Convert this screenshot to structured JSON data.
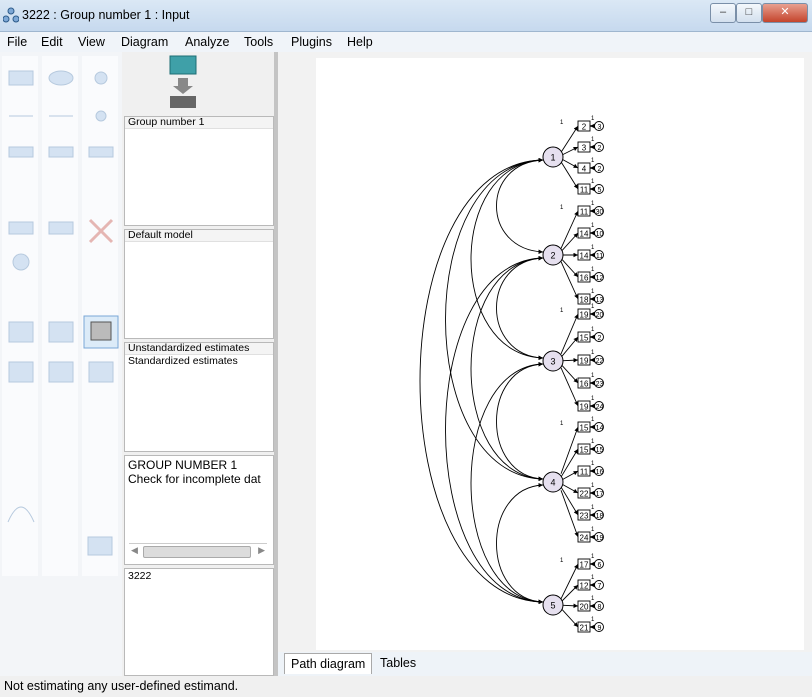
{
  "window": {
    "title": "3222 : Group number 1 : Input",
    "minimize": "–",
    "maximize": "□",
    "close": "✕"
  },
  "menu": [
    "File",
    "Edit",
    "View",
    "Diagram",
    "Analyze",
    "Tools",
    "Plugins",
    "Help"
  ],
  "panels": {
    "groups": "Group number 1",
    "models": "Default model",
    "estimates": [
      "Unstandardized estimates",
      "Standardized estimates"
    ],
    "messages": [
      "GROUP NUMBER 1",
      "Check for incomplete dat"
    ],
    "file": "3222"
  },
  "tabs": {
    "path": "Path diagram",
    "tables": "Tables"
  },
  "status": "Not estimating any user-defined estimand.",
  "diagram": {
    "factors": [
      {
        "label": "1",
        "items": [
          "2",
          "3",
          "4",
          "11"
        ],
        "errors": [
          "3",
          "2",
          "2",
          "5"
        ]
      },
      {
        "label": "2",
        "items": [
          "11",
          "14",
          "14",
          "16",
          "18"
        ],
        "errors": [
          "30",
          "10",
          "11",
          "12",
          "13"
        ]
      },
      {
        "label": "3",
        "items": [
          "19",
          "15",
          "19",
          "16",
          "19"
        ],
        "errors": [
          "20",
          "2",
          "22",
          "23",
          "24"
        ]
      },
      {
        "label": "4",
        "items": [
          "15",
          "15",
          "11",
          "22",
          "23",
          "24"
        ],
        "errors": [
          "14",
          "15",
          "16",
          "17",
          "18",
          "19"
        ]
      },
      {
        "label": "5",
        "items": [
          "17",
          "12",
          "20",
          "21"
        ],
        "errors": [
          "6",
          "7",
          "8",
          "9"
        ]
      }
    ],
    "path_label": "1"
  },
  "colors": {
    "latent_fill": "#e6e0ef",
    "accent": "#3a6ea5"
  }
}
